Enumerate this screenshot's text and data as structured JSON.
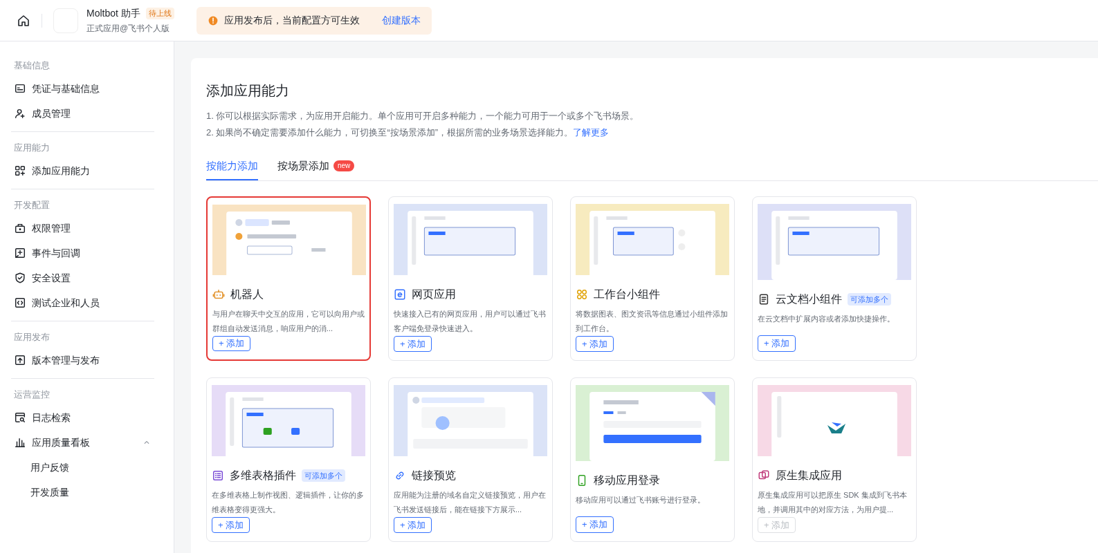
{
  "header": {
    "app_name": "Moltbot 助手",
    "status_badge": "待上线",
    "app_subtitle": "正式应用@飞书个人版",
    "notice": "应用发布后，当前配置方可生效",
    "notice_link": "创建版本"
  },
  "sidebar": {
    "groups": [
      {
        "title": "基础信息",
        "items": [
          {
            "label": "凭证与基础信息",
            "kind": "card",
            "selected": false
          },
          {
            "label": "成员管理",
            "kind": "user",
            "selected": false
          }
        ]
      },
      {
        "title": "应用能力",
        "items": [
          {
            "label": "添加应用能力",
            "kind": "grid",
            "selected": false
          }
        ]
      },
      {
        "title": "开发配置",
        "items": [
          {
            "label": "权限管理",
            "kind": "lock",
            "selected": false
          },
          {
            "label": "事件与回调",
            "kind": "event",
            "selected": false
          },
          {
            "label": "安全设置",
            "kind": "shield",
            "selected": false
          },
          {
            "label": "测试企业和人员",
            "kind": "code",
            "selected": false
          }
        ]
      },
      {
        "title": "应用发布",
        "items": [
          {
            "label": "版本管理与发布",
            "kind": "upload",
            "selected": false
          }
        ]
      },
      {
        "title": "运营监控",
        "items": [
          {
            "label": "日志检索",
            "kind": "log",
            "selected": false
          },
          {
            "label": "应用质量看板",
            "kind": "chart",
            "selected": false,
            "expanded": true,
            "children": [
              {
                "label": "用户反馈",
                "selected": false
              },
              {
                "label": "开发质量",
                "selected": false
              }
            ]
          }
        ]
      }
    ]
  },
  "main": {
    "title": "添加应用能力",
    "lines": [
      "1. 你可以根据实际需求，为应用开启能力。单个应用可开启多种能力，一个能力可用于一个或多个飞书场景。",
      "2. 如果尚不确定需要添加什么能力，可切换至“按场景添加”，根据所需的业务场景选择能力。"
    ],
    "learn_more": "了解更多",
    "tabs": [
      {
        "label": "按能力添加",
        "selected": true
      },
      {
        "label": "按场景添加",
        "badge": "new",
        "selected": false
      }
    ],
    "cards": [
      {
        "title": "机器人",
        "kind": "robot",
        "color": "#f9e3c2",
        "description": "与用户在聊天中交互的应用，它可以向用户或群组自动发送消息，响应用户的消...",
        "button": "+ 添加",
        "disabled": false,
        "selected": true
      },
      {
        "title": "网页应用",
        "kind": "web",
        "color": "#dbe3f7",
        "description": "快速接入已有的网页应用，用户可以通过飞书客户端免登录快速进入。",
        "button": "+ 添加",
        "disabled": false,
        "selected": false
      },
      {
        "title": "工作台小组件",
        "kind": "widget",
        "color": "#f7ebbf",
        "description": "将数据图表、图文资讯等信息通过小组件添加到工作台。",
        "button": "+ 添加",
        "disabled": false,
        "selected": false
      },
      {
        "title": "云文档小组件",
        "kind": "doc",
        "color": "#dde0f7",
        "tag": "可添加多个",
        "description": "在云文档中扩展内容或者添加快捷操作。",
        "button": "+ 添加",
        "disabled": false,
        "selected": false
      },
      {
        "title": "多维表格插件",
        "kind": "table",
        "color": "#e6dcf7",
        "tag": "可添加多个",
        "description": "在多维表格上制作视图、逻辑插件，让你的多维表格变得更强大。",
        "button": "+ 添加",
        "disabled": false,
        "selected": false
      },
      {
        "title": "链接预览",
        "kind": "link",
        "color": "#dbe3f7",
        "description": "应用能为注册的域名自定义链接预览，用户在飞书发送链接后，能在链接下方展示...",
        "button": "+ 添加",
        "disabled": false,
        "selected": false
      },
      {
        "title": "移动应用登录",
        "kind": "phone",
        "color": "#d9f0d3",
        "description": "移动应用可以通过飞书账号进行登录。",
        "button": "+ 添加",
        "disabled": false,
        "selected": false
      },
      {
        "title": "原生集成应用",
        "kind": "native",
        "color": "#f7d9e6",
        "description": "原生集成应用可以把原生 SDK 集成到飞书本地，并调用其中的对应方法，为用户提...",
        "button": "+ 添加",
        "disabled": true,
        "selected": false
      }
    ]
  }
}
